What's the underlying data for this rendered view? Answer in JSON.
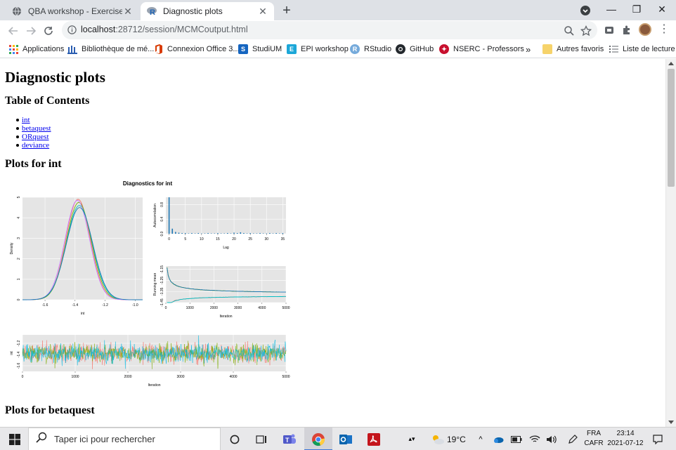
{
  "browser": {
    "tabs": [
      {
        "title": "QBA workshop - Exercises - Baye",
        "active": false
      },
      {
        "title": "Diagnostic plots",
        "active": true
      }
    ],
    "new_tab": "+",
    "url_host": "localhost",
    "url_path": ":28712/session/MCMCoutput.html",
    "window_controls": {
      "minimize": "—",
      "restore": "❐",
      "close": "✕"
    }
  },
  "bookmarks": {
    "items": [
      {
        "label": "Applications",
        "icon": "apps-grid-icon",
        "color": "#4285f4"
      },
      {
        "label": "Bibliothèque de mé...",
        "icon": "library-icon",
        "color": "#2a5db0"
      },
      {
        "label": "Connexion Office 3...",
        "icon": "office-icon",
        "color": "#d83b01"
      },
      {
        "label": "StudiUM",
        "icon": "studium-icon",
        "color": "#1565c0"
      },
      {
        "label": "EPI workshop",
        "icon": "epi-icon",
        "color": "#1ca7d8"
      },
      {
        "label": "RStudio",
        "icon": "rstudio-icon",
        "color": "#75aadb"
      },
      {
        "label": "GitHub",
        "icon": "github-icon",
        "color": "#24292e"
      },
      {
        "label": "NSERC - Professors",
        "icon": "nserc-icon",
        "color": "#c8102e"
      }
    ],
    "overflow": "»",
    "other_favorites": "Autres favoris",
    "reading_list": "Liste de lecture"
  },
  "page": {
    "title": "Diagnostic plots",
    "toc_heading": "Table of Contents",
    "toc": [
      "int",
      "betaquest",
      "ORquest",
      "deviance"
    ],
    "section_int": "Plots for int",
    "section_beta": "Plots for betaquest"
  },
  "chart_data": [
    {
      "type": "line",
      "title": "Diagnostics for int",
      "panel": "density",
      "xlabel": "int",
      "ylabel": "Density",
      "xlim": [
        -1.75,
        -0.95
      ],
      "ylim": [
        0,
        5
      ],
      "x_ticks": [
        "-1.6",
        "-1.4",
        "-1.2",
        "-1.0"
      ],
      "y_ticks": [
        "0",
        "1",
        "2",
        "3",
        "4",
        "5"
      ],
      "series": [
        {
          "color": "#f8766d",
          "mean": -1.38,
          "sd": 0.081,
          "peak": 4.9
        },
        {
          "color": "#7cae00",
          "mean": -1.375,
          "sd": 0.083,
          "peak": 4.75
        },
        {
          "color": "#00bfc4",
          "mean": -1.372,
          "sd": 0.086,
          "peak": 4.6
        },
        {
          "color": "#c77cff",
          "mean": -1.385,
          "sd": 0.082,
          "peak": 4.85
        },
        {
          "color": "#1f78b4",
          "mean": -1.37,
          "sd": 0.088,
          "peak": 4.5
        }
      ]
    },
    {
      "type": "bar",
      "panel": "autocorrelation",
      "xlabel": "Lag",
      "ylabel": "Autocorrelation",
      "xlim": [
        -1,
        36
      ],
      "ylim": [
        0,
        1
      ],
      "x_ticks": [
        "0",
        "5",
        "10",
        "15",
        "20",
        "25",
        "30",
        "35"
      ],
      "y_ticks": [
        "0.0",
        "0.4",
        "0.8"
      ],
      "lags": [
        0,
        1,
        2,
        3,
        4,
        5,
        6,
        7,
        8,
        9,
        10,
        11,
        12,
        13,
        14,
        15,
        16,
        17,
        18,
        19,
        20,
        21,
        22,
        23,
        24,
        25,
        26,
        27,
        28,
        29,
        30,
        31,
        32,
        33,
        34,
        35
      ],
      "values": [
        1.0,
        0.14,
        0.05,
        0.03,
        0.02,
        0.02,
        0.01,
        0.02,
        0.01,
        0.02,
        0.01,
        0.01,
        0.02,
        0.01,
        0.01,
        0.02,
        0.01,
        0.01,
        0.02,
        0.01,
        0.03,
        0.02,
        0.04,
        0.02,
        0.01,
        0.02,
        0.01,
        0.01,
        0.02,
        0.01,
        0.01,
        0.02,
        0.01,
        0.02,
        0.01,
        0.02
      ]
    },
    {
      "type": "line",
      "panel": "running-mean",
      "xlabel": "Iteration",
      "ylabel": "Running mean",
      "xlim": [
        0,
        5000
      ],
      "ylim": [
        -1.45,
        -1.12
      ],
      "x_ticks": [
        "0",
        "1000",
        "2000",
        "3000",
        "4000",
        "5000"
      ],
      "y_ticks": [
        "-1.45",
        "-1.35",
        "-1.25",
        "-1.15"
      ],
      "converged_value": -1.38
    },
    {
      "type": "line",
      "panel": "trace",
      "xlabel": "Iteration",
      "ylabel": "int",
      "xlim": [
        0,
        5000
      ],
      "ylim": [
        -1.7,
        -1.05
      ],
      "x_ticks": [
        "0",
        "1000",
        "2000",
        "3000",
        "4000",
        "5000"
      ],
      "y_ticks": [
        "-1.6",
        "-1.4",
        "-1.2"
      ],
      "chains": [
        {
          "color": "#f8766d",
          "mean": -1.38,
          "sd": 0.08
        },
        {
          "color": "#7cae00",
          "mean": -1.38,
          "sd": 0.08
        },
        {
          "color": "#00b9e3",
          "mean": -1.38,
          "sd": 0.085
        }
      ]
    }
  ],
  "taskbar": {
    "search_placeholder": "Taper ici pour rechercher",
    "weather": "19°C",
    "lang_top": "FRA",
    "lang_bottom": "CAFR",
    "time": "23:14",
    "date": "2021-07-12"
  }
}
